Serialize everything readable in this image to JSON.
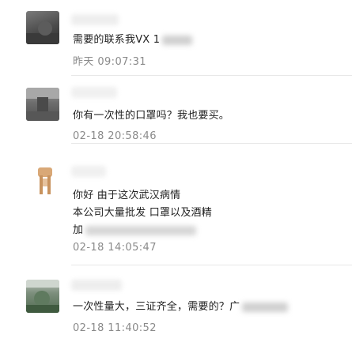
{
  "comments": [
    {
      "avatar_icon": "user-avatar-icon",
      "lines": [
        "需要的联系我VX 1"
      ],
      "time": "昨天 09:07:31"
    },
    {
      "avatar_icon": "user-avatar-icon",
      "lines": [
        "你有一次性的口罩吗？我也要买。"
      ],
      "time": "02-18 20:58:46"
    },
    {
      "avatar_icon": "user-avatar-icon",
      "lines": [
        "你好 由于这次武汉病情",
        "本公司大量批发 口罩以及酒精",
        "加"
      ],
      "time": "02-18 14:05:47"
    },
    {
      "avatar_icon": "user-avatar-icon",
      "lines": [
        "一次性量大，三证齐全，需要的？广"
      ],
      "time": "02-18 11:40:52"
    }
  ],
  "colors": {
    "text": "#222222",
    "timestamp": "#8a8a8a",
    "divider": "#e8e8e8"
  }
}
